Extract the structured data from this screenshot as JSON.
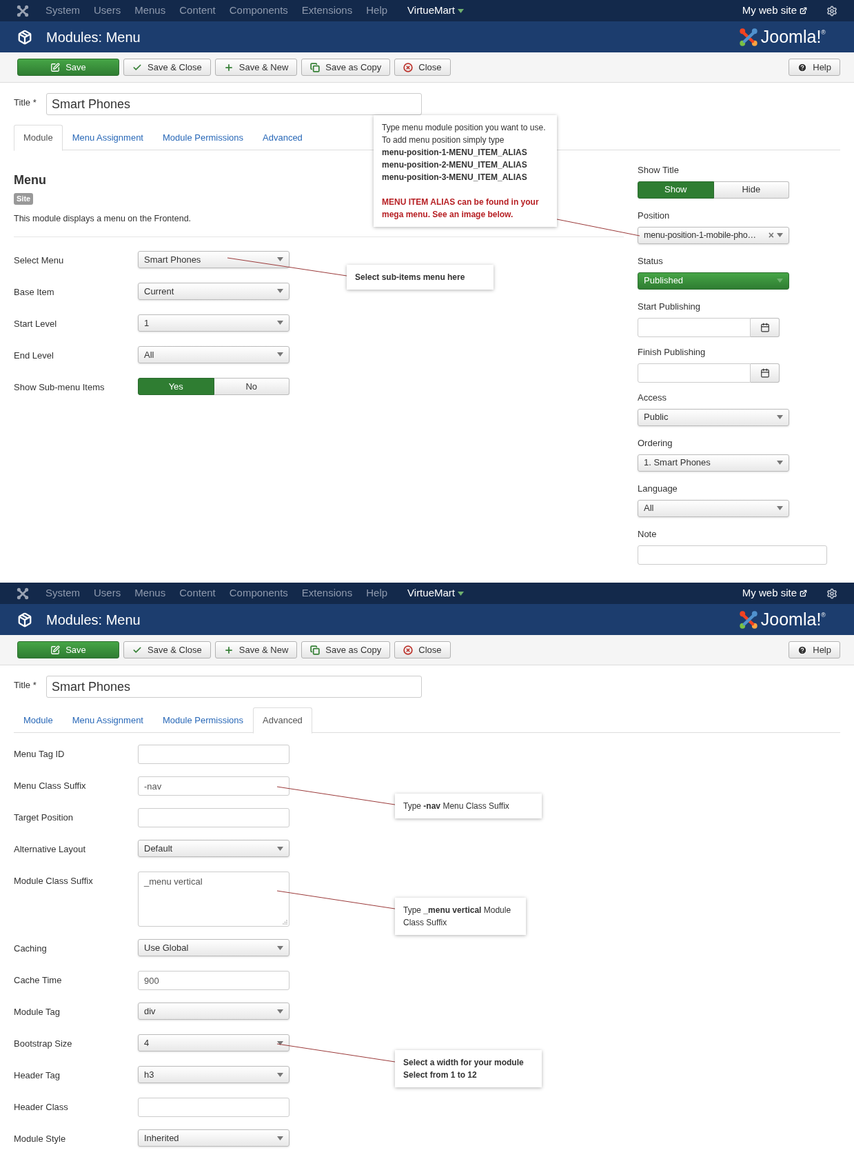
{
  "screens": [
    {
      "nav": {
        "items": [
          "System",
          "Users",
          "Menus",
          "Content",
          "Components",
          "Extensions",
          "Help"
        ],
        "extra": "VirtueMart",
        "site": "My web site"
      },
      "header": {
        "title": "Modules: Menu",
        "brand": "Joomla!",
        "brand_mark": "®"
      },
      "toolbar": {
        "buttons": [
          {
            "label": "Save",
            "kind": "save"
          },
          {
            "label": "Save & Close",
            "kind": "save-close"
          },
          {
            "label": "Save & New",
            "kind": "save-new"
          },
          {
            "label": "Save as Copy",
            "kind": "save-copy"
          },
          {
            "label": "Close",
            "kind": "close"
          }
        ],
        "help": "Help"
      },
      "title_field": {
        "label": "Title *",
        "value": "Smart Phones"
      },
      "tabs": [
        {
          "label": "Module",
          "selected": true
        },
        {
          "label": "Menu Assignment",
          "selected": false
        },
        {
          "label": "Module Permissions",
          "selected": false
        },
        {
          "label": "Advanced",
          "selected": false
        }
      ],
      "module": {
        "heading": "Menu",
        "badge": "Site",
        "description": "This module displays a menu on the Frontend."
      },
      "fields": [
        {
          "label": "Select Menu",
          "kind": "select",
          "value": "Smart Phones"
        },
        {
          "label": "Base Item",
          "kind": "select",
          "value": "Current"
        },
        {
          "label": "Start Level",
          "kind": "select",
          "value": "1"
        },
        {
          "label": "End Level",
          "kind": "select",
          "value": "All"
        },
        {
          "label": "Show Sub-menu Items",
          "kind": "toggle",
          "options": [
            {
              "label": "Yes",
              "selected": true
            },
            {
              "label": "No",
              "selected": false
            }
          ]
        }
      ],
      "sidebar": [
        {
          "label": "Show Title",
          "kind": "toggle",
          "options": [
            {
              "label": "Show",
              "selected": true
            },
            {
              "label": "Hide",
              "selected": false
            }
          ]
        },
        {
          "label": "Position",
          "kind": "position",
          "value": "menu-position-1-mobile-pho…",
          "clear": "×"
        },
        {
          "label": "Status",
          "kind": "status",
          "value": "Published"
        },
        {
          "label": "Start Publishing",
          "kind": "date"
        },
        {
          "label": "Finish Publishing",
          "kind": "date"
        },
        {
          "label": "Access",
          "kind": "select",
          "value": "Public"
        },
        {
          "label": "Ordering",
          "kind": "select",
          "value": "1. Smart Phones"
        },
        {
          "label": "Language",
          "kind": "select",
          "value": "All"
        },
        {
          "label": "Note",
          "kind": "wide-text"
        }
      ],
      "callouts": [
        {
          "lines": [
            {
              "text": "Type menu module position you want to use.",
              "kind": "normal"
            },
            {
              "text": "To add menu position simply type",
              "kind": "normal"
            },
            {
              "text": "menu-position-1-MENU_ITEM_ALIAS",
              "kind": "bold"
            },
            {
              "text": "menu-position-2-MENU_ITEM_ALIAS",
              "kind": "bold"
            },
            {
              "text": "menu-position-3-MENU_ITEM_ALIAS",
              "kind": "bold"
            },
            {
              "text": "MENU ITEM ALIAS can be found in your",
              "kind": "alert"
            },
            {
              "text": "mega menu. See an image below.",
              "kind": "alert"
            }
          ]
        },
        {
          "lines": [
            {
              "text": "Select sub-items menu here",
              "kind": "bold"
            }
          ]
        }
      ]
    },
    {
      "nav": {
        "items": [
          "System",
          "Users",
          "Menus",
          "Content",
          "Components",
          "Extensions",
          "Help"
        ],
        "extra": "VirtueMart",
        "site": "My web site"
      },
      "header": {
        "title": "Modules: Menu",
        "brand": "Joomla!",
        "brand_mark": "®"
      },
      "toolbar": {
        "buttons": [
          {
            "label": "Save",
            "kind": "save"
          },
          {
            "label": "Save & Close",
            "kind": "save-close"
          },
          {
            "label": "Save & New",
            "kind": "save-new"
          },
          {
            "label": "Save as Copy",
            "kind": "save-copy"
          },
          {
            "label": "Close",
            "kind": "close"
          }
        ],
        "help": "Help"
      },
      "title_field": {
        "label": "Title *",
        "value": "Smart Phones"
      },
      "tabs": [
        {
          "label": "Module",
          "selected": false
        },
        {
          "label": "Menu Assignment",
          "selected": false
        },
        {
          "label": "Module Permissions",
          "selected": false
        },
        {
          "label": "Advanced",
          "selected": true
        }
      ],
      "fields": [
        {
          "label": "Menu Tag ID",
          "kind": "text"
        },
        {
          "label": "Menu Class Suffix",
          "kind": "text",
          "value": "-nav"
        },
        {
          "label": "Target Position",
          "kind": "text"
        },
        {
          "label": "Alternative Layout",
          "kind": "select",
          "value": "Default"
        },
        {
          "label": "Module Class Suffix",
          "kind": "textarea",
          "value": "_menu vertical"
        },
        {
          "label": "Caching",
          "kind": "select",
          "value": "Use Global"
        },
        {
          "label": "Cache Time",
          "kind": "text",
          "value": "900"
        },
        {
          "label": "Module Tag",
          "kind": "select",
          "value": "div"
        },
        {
          "label": "Bootstrap Size",
          "kind": "select",
          "value": "4"
        },
        {
          "label": "Header Tag",
          "kind": "select",
          "value": "h3"
        },
        {
          "label": "Header Class",
          "kind": "text"
        },
        {
          "label": "Module Style",
          "kind": "select",
          "value": "Inherited"
        }
      ],
      "callouts": [
        {
          "lines": [
            {
              "text": "Type **-nav** Menu Class Suffix",
              "kind": "normal"
            }
          ]
        },
        {
          "lines": [
            {
              "text": "Type **_menu vertical** Module Class Suffix",
              "kind": "normal"
            }
          ]
        },
        {
          "lines": [
            {
              "text": "Select a width for your module",
              "kind": "bold"
            },
            {
              "text": "Select from 1 to 12",
              "kind": "bold"
            }
          ]
        }
      ]
    }
  ]
}
